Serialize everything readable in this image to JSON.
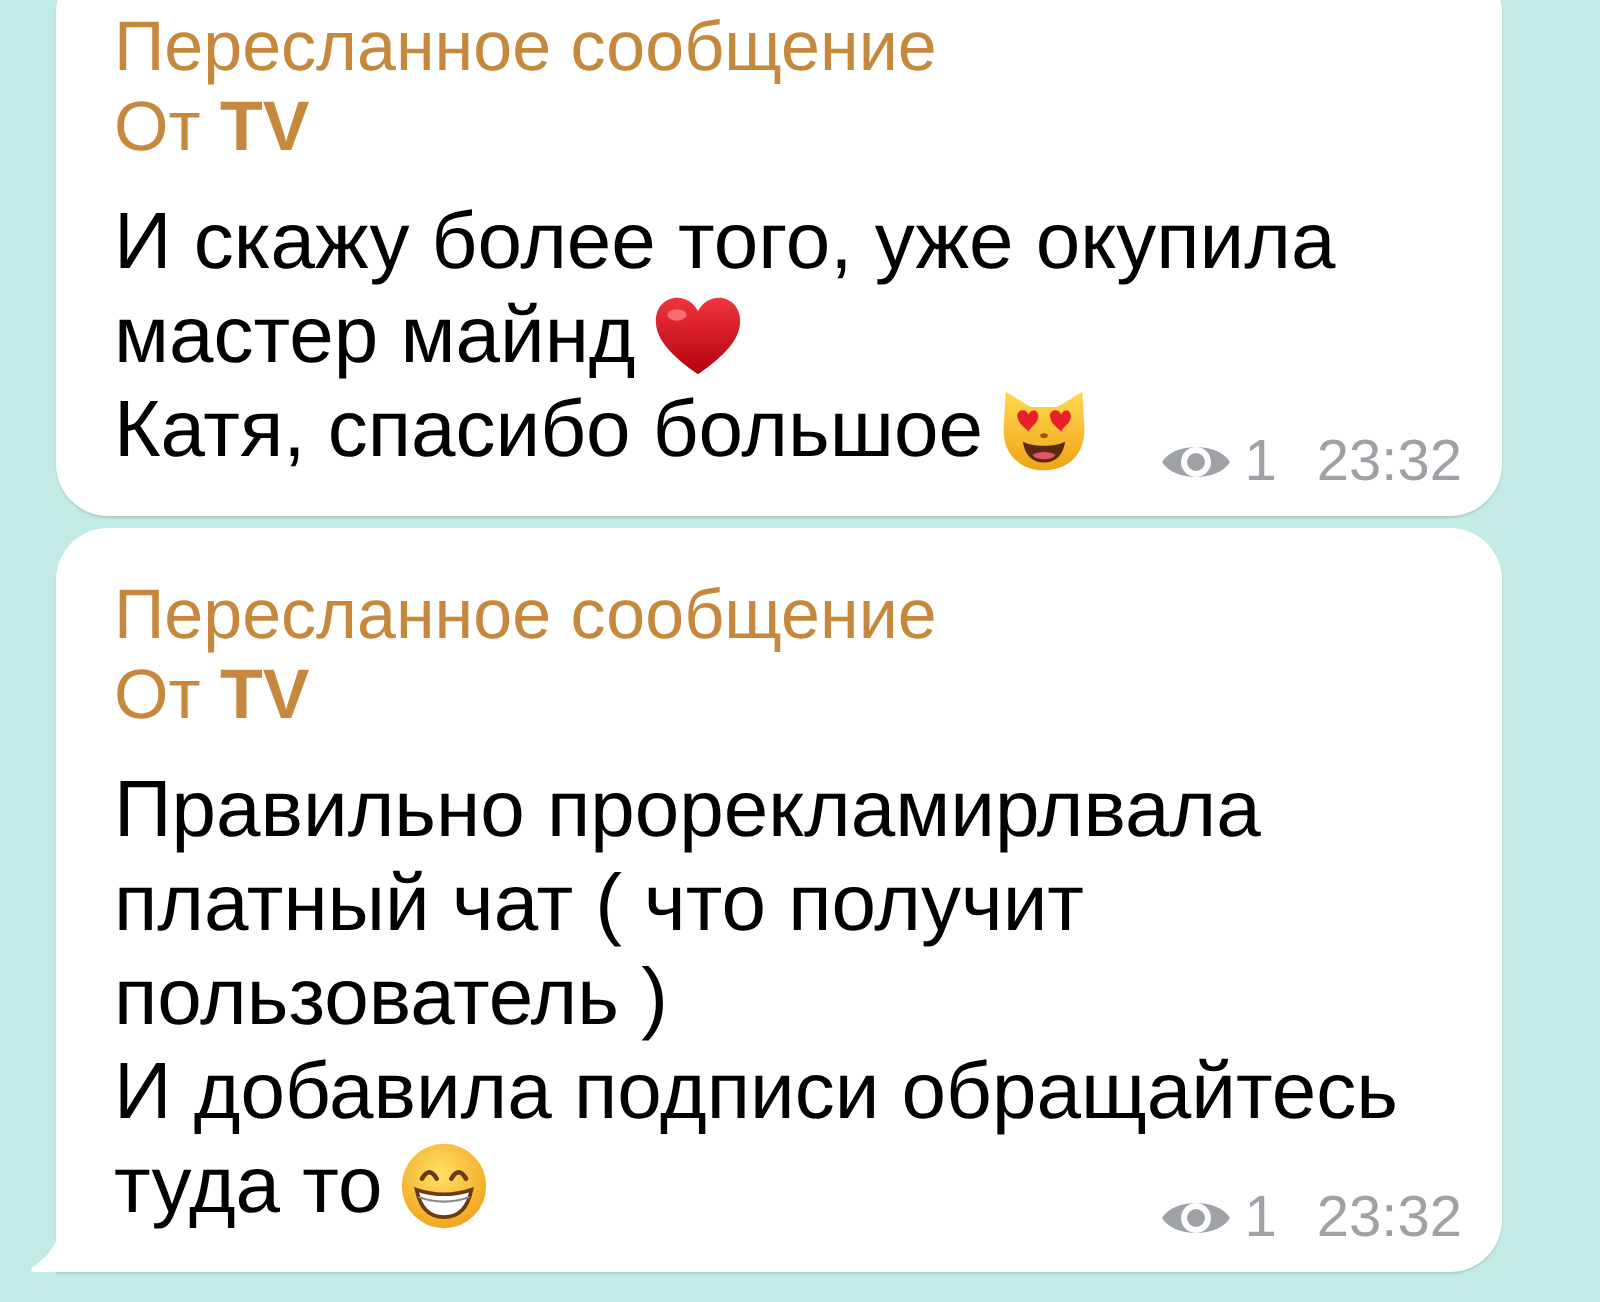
{
  "messages": [
    {
      "forwarded_label": "Пересланное сообщение",
      "from": "От **TV**",
      "body": [
        {
          "text": "И скажу более того, уже окупила\nмастер майнд",
          "emoji": {
            "kind": "heart"
          }
        },
        {
          "text": "Катя, спасибо большое",
          "emoji": {
            "kind": "cat"
          }
        }
      ],
      "views": "1",
      "time": "23:32",
      "tail": false
    },
    {
      "forwarded_label": "Пересланное сообщение",
      "from": "От **TV**",
      "body": [
        {
          "text": "Правильно прорекламирлвала\nплатный чат ( что получит\nпользователь )"
        },
        {
          "text": "И добавила подписи обращайтесь\nтуда то",
          "emoji": {
            "kind": "grin"
          }
        }
      ],
      "views": "1",
      "time": "23:32",
      "tail": true
    }
  ]
}
